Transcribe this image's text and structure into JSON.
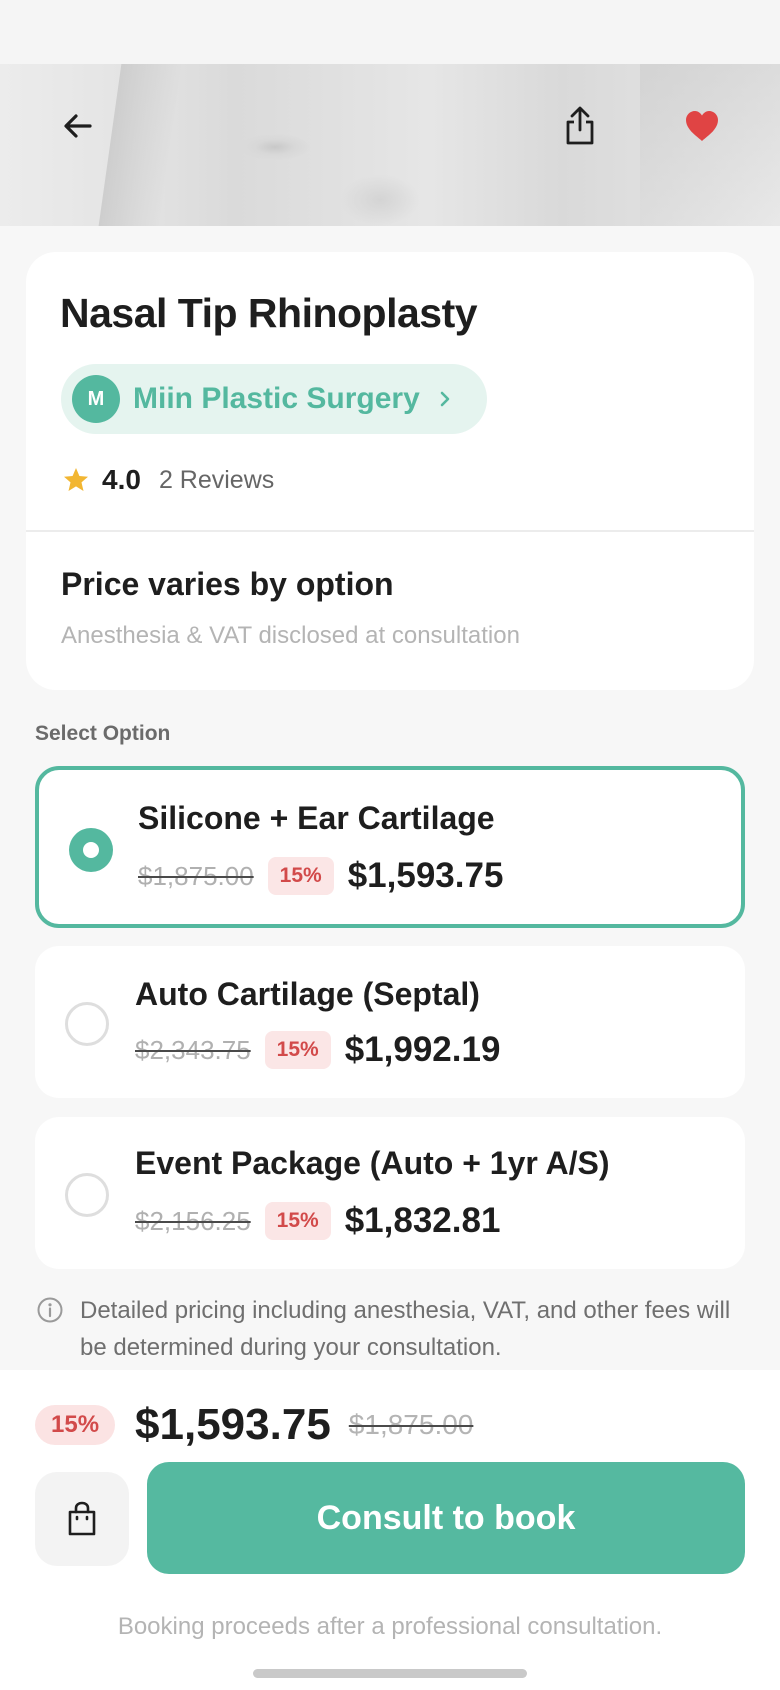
{
  "header": {
    "back_icon": "arrow-left-icon",
    "share_icon": "share-icon",
    "favorite_icon": "heart-icon",
    "favorite_color": "#e04444"
  },
  "product": {
    "title": "Nasal Tip Rhinoplasty",
    "clinic": {
      "avatar_letter": "M",
      "name": "Miin Plastic Surgery"
    },
    "rating": "4.0",
    "review_count": "2 Reviews",
    "price_heading": "Price varies by option",
    "price_note": "Anesthesia & VAT disclosed at consultation"
  },
  "options_section": {
    "label": "Select Option",
    "selected_index": 0,
    "options": [
      {
        "name": "Silicone + Ear Cartilage",
        "original_price": "$1,875.00",
        "discount": "15%",
        "price": "$1,593.75"
      },
      {
        "name": "Auto Cartilage (Septal)",
        "original_price": "$2,343.75",
        "discount": "15%",
        "price": "$1,992.19"
      },
      {
        "name": "Event Package (Auto + 1yr A/S)",
        "original_price": "$2,156.25",
        "discount": "15%",
        "price": "$1,832.81"
      }
    ]
  },
  "info_note": "Detailed pricing including anesthesia, VAT, and other fees will be determined during your consultation.",
  "bottom_bar": {
    "discount": "15%",
    "price": "$1,593.75",
    "original_price": "$1,875.00",
    "cta_label": "Consult to book",
    "booking_note": "Booking proceeds after a professional consultation."
  },
  "colors": {
    "accent": "#54b89f",
    "discount_red": "#d24a4a"
  }
}
